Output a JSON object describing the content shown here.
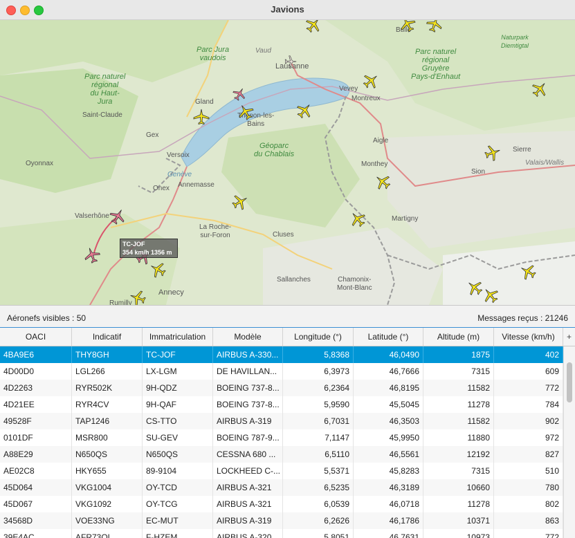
{
  "window": {
    "title": "Javions"
  },
  "map": {
    "labels": {
      "bulle": "Bulle",
      "vaud": "Vaud",
      "lausanne": "Lausanne",
      "jura_vaudois": "Parc Jura\nvaudois",
      "naturpark": "Naturpark\nDiemtigtal",
      "gruyere": "Parc naturel\nrégional\nGruyère\nPays-d'Enhaut",
      "haut_jura": "Parc naturel\nrégional\ndu Haut-\nJura",
      "vevey": "Vevey",
      "montreux": "Montreux",
      "gland": "Gland",
      "thonon": "Thonon-les-\nBains",
      "saint_claude": "Saint-Claude",
      "gex": "Gex",
      "versoix": "Versoix",
      "geoparc": "Géoparc\ndu Chablais",
      "aigle": "Aigle",
      "oyonnax": "Oyonnax",
      "geneve": "Genève",
      "onex": "Onex",
      "annemasse": "Annemasse",
      "monthey": "Monthey",
      "sierre": "Sierre",
      "valais": "Valais/Wallis",
      "sion": "Sion",
      "valserhone": "Valserhône",
      "roche": "La Roche-\nsur-Foron",
      "cluses": "Cluses",
      "martigny": "Martigny",
      "sallanches": "Sallanches",
      "chamonix": "Chamonix-\nMont-Blanc",
      "annecy": "Annecy",
      "rumilly": "Rumilly"
    },
    "tooltip": {
      "line1": "TC-JOF",
      "line2": "354 km/h  1356 m"
    }
  },
  "status": {
    "visible": "Aéronefs visibles : 50",
    "received": "Messages reçus : 21246"
  },
  "table": {
    "columns": [
      "OACI",
      "Indicatif",
      "Immatriculation",
      "Modèle",
      "Longitude (°)",
      "Latitude (°)",
      "Altitude (m)",
      "Vitesse (km/h)"
    ],
    "corner": "+",
    "rows": [
      [
        "4BA9E6",
        "THY8GH",
        "TC-JOF",
        "AIRBUS A-330...",
        "5,8368",
        "46,0490",
        "1875",
        "402"
      ],
      [
        "4D00D0",
        "LGL266",
        "LX-LGM",
        "DE HAVILLAN...",
        "6,3973",
        "46,7666",
        "7315",
        "609"
      ],
      [
        "4D2263",
        "RYR502K",
        "9H-QDZ",
        "BOEING 737-8...",
        "6,2364",
        "46,8195",
        "11582",
        "772"
      ],
      [
        "4D21EE",
        "RYR4CV",
        "9H-QAF",
        "BOEING 737-8...",
        "5,9590",
        "45,5045",
        "11278",
        "784"
      ],
      [
        "49528F",
        "TAP1246",
        "CS-TTO",
        "AIRBUS A-319",
        "6,7031",
        "46,3503",
        "11582",
        "902"
      ],
      [
        "0101DF",
        "MSR800",
        "SU-GEV",
        "BOEING 787-9...",
        "7,1147",
        "45,9950",
        "11880",
        "972"
      ],
      [
        "A88E29",
        "N650QS",
        "N650QS",
        "CESSNA 680 ...",
        "6,5110",
        "46,5561",
        "12192",
        "827"
      ],
      [
        "AE02C8",
        "HKY655",
        "89-9104",
        "LOCKHEED C-...",
        "5,5371",
        "45,8283",
        "7315",
        "510"
      ],
      [
        "45D064",
        "VKG1004",
        "OY-TCD",
        "AIRBUS A-321",
        "6,5235",
        "46,3189",
        "10660",
        "780"
      ],
      [
        "45D067",
        "VKG1092",
        "OY-TCG",
        "AIRBUS A-321",
        "6,0539",
        "46,0718",
        "11278",
        "802"
      ],
      [
        "34568D",
        "VOE33NG",
        "EC-MUT",
        "AIRBUS A-319",
        "6,2626",
        "46,1786",
        "10371",
        "863"
      ],
      [
        "39E4AC",
        "AFR73QL",
        "F-HZEM",
        "AIRBUS A-320...",
        "5,8051",
        "46,7631",
        "10973",
        "772"
      ]
    ]
  }
}
